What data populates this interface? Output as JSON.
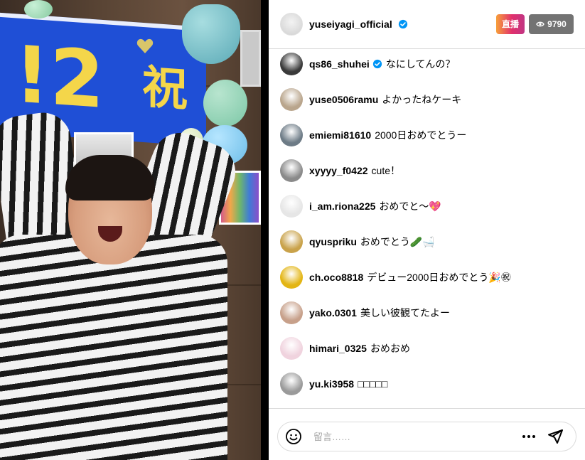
{
  "video": {
    "banner_text": "!2",
    "banner_kanji": "祝"
  },
  "header": {
    "username": "yuseiyagi_official",
    "verified": true,
    "live_label": "直播",
    "viewer_count": "9790"
  },
  "comments": [
    {
      "username": "qs86_shuhei",
      "verified": true,
      "text": "なにしてんの？",
      "avatar_color": "#3a3a3a"
    },
    {
      "username": "yuse0506ramu",
      "verified": false,
      "text": "よかったねケーキ",
      "avatar_color": "#b9a58c"
    },
    {
      "username": "emiemi81610",
      "verified": false,
      "text": "2000日おめでとうー",
      "avatar_color": "#6d7b86"
    },
    {
      "username": "xyyyy_f0422",
      "verified": false,
      "text": "cute！",
      "avatar_color": "#8a8a8a"
    },
    {
      "username": "i_am.riona225",
      "verified": false,
      "text": "おめでと〜💖",
      "avatar_color": "#e6e6e6"
    },
    {
      "username": "qyuspriku",
      "verified": false,
      "text": "おめでとう🥒🛁",
      "avatar_color": "#c9a24a"
    },
    {
      "username": "ch.oco8818",
      "verified": false,
      "text": "デビュー2000日おめでとう🎉㊗",
      "avatar_color": "#e3b514"
    },
    {
      "username": "yako.0301",
      "verified": false,
      "text": "美しい彼観てたよー",
      "avatar_color": "#c7a08a"
    },
    {
      "username": "himari_0325",
      "verified": false,
      "text": "おめおめ",
      "avatar_color": "#f0d3de"
    },
    {
      "username": "yu.ki3958",
      "verified": false,
      "text": "□□□□□",
      "avatar_color": "#9a9a9a"
    }
  ],
  "composer": {
    "placeholder": "留言……"
  },
  "colors": {
    "verified": "#0095f6",
    "live_gradient_start": "#f7a03a",
    "live_gradient_end": "#c13584",
    "viewer_badge": "#737373"
  }
}
